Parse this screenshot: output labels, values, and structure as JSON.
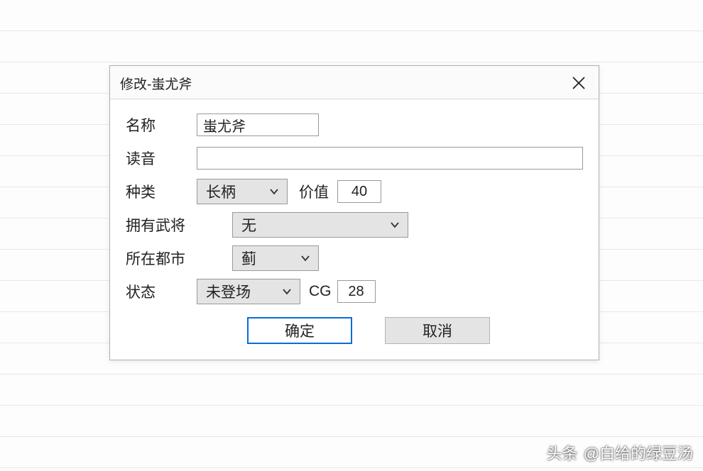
{
  "dialog": {
    "title": "修改-蚩尤斧",
    "fields": {
      "name_label": "名称",
      "name_value": "蚩尤斧",
      "reading_label": "读音",
      "reading_value": "",
      "type_label": "种类",
      "type_value": "长柄",
      "value_label": "价值",
      "value_number": "40",
      "owner_label": "拥有武将",
      "owner_value": "无",
      "city_label": "所在都市",
      "city_value": "蓟",
      "status_label": "状态",
      "status_value": "未登场",
      "cg_label": "CG",
      "cg_value": "28"
    },
    "buttons": {
      "ok": "确定",
      "cancel": "取消"
    }
  },
  "watermark": {
    "prefix": "头条",
    "handle": "@白给的绿豆汤"
  }
}
